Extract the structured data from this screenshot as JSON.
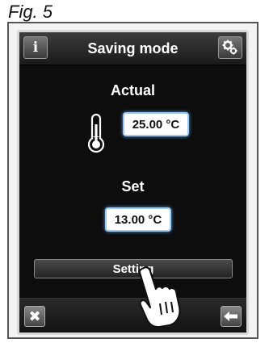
{
  "figure": {
    "label": "Fig. 5"
  },
  "header": {
    "title": "Saving mode",
    "info_glyph": "i",
    "info_icon": "info-icon",
    "settings_icon": "gears-icon"
  },
  "actual": {
    "label": "Actual",
    "value": "25.00 °C",
    "icon": "thermometer-icon"
  },
  "set": {
    "label": "Set",
    "value": "13.00 °C"
  },
  "setting_button": {
    "label": "Setting"
  },
  "footer": {
    "close_glyph": "✖",
    "close_icon": "close-icon",
    "back_icon": "back-arrow-icon"
  },
  "colors": {
    "screen_bg": "#0d0d0d",
    "value_border": "#9ec9f3",
    "text": "#ffffff"
  }
}
